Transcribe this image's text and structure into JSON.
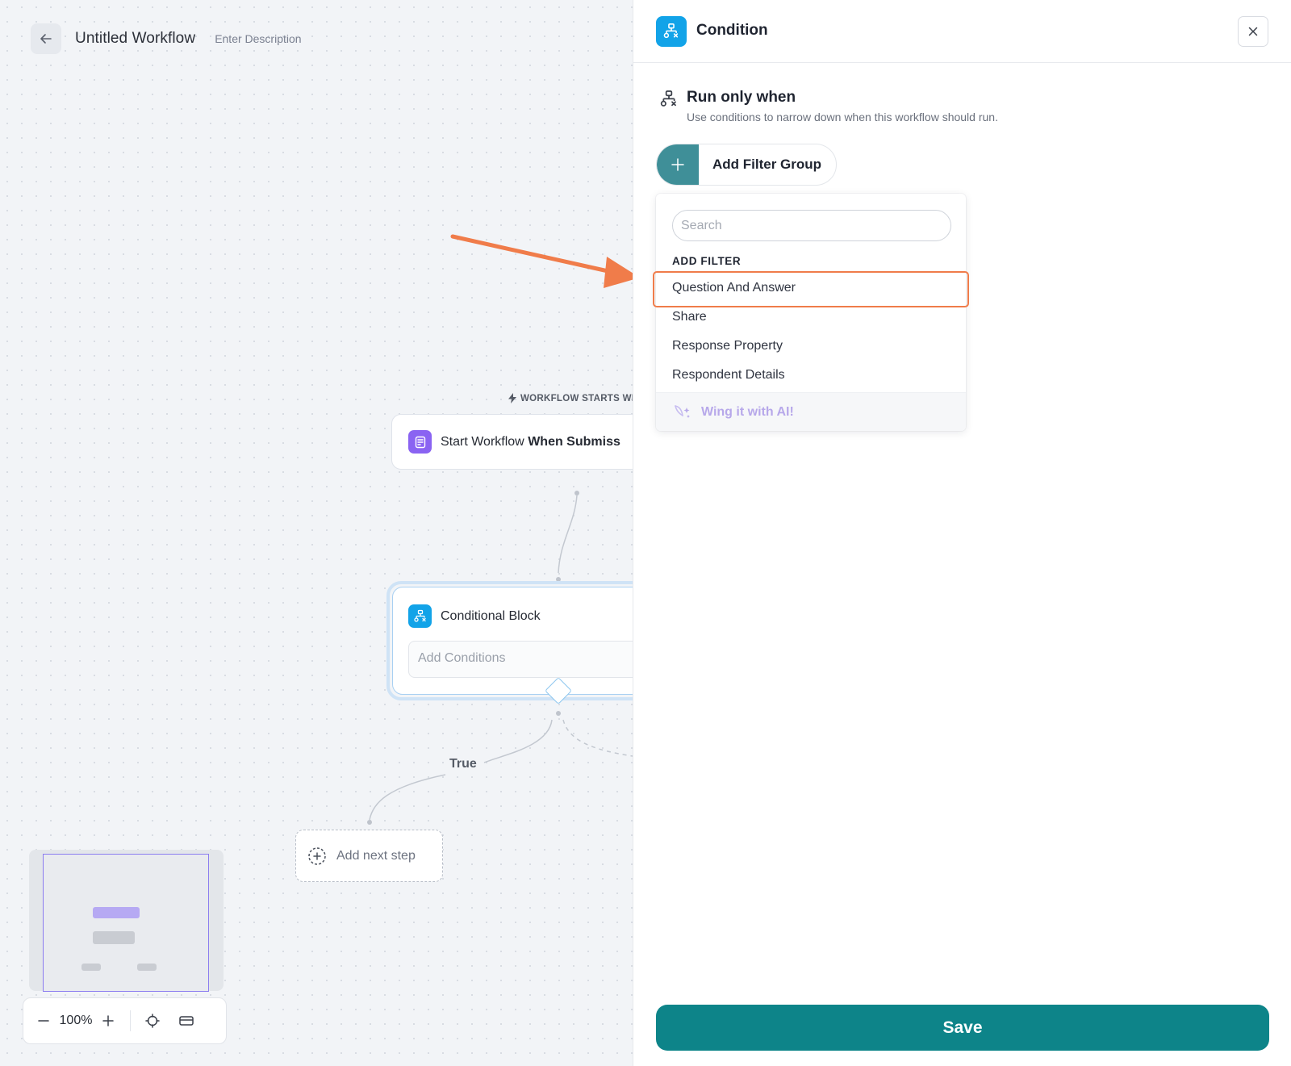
{
  "topbar": {
    "title": "Untitled Workflow",
    "description": "Enter Description"
  },
  "canvas": {
    "starts_label": "WORKFLOW STARTS WH",
    "trigger_node": {
      "prefix": "Start Workflow",
      "bold": "When Submiss"
    },
    "condition_node": {
      "title": "Conditional Block",
      "placeholder": "Add Conditions"
    },
    "branch_label": "True",
    "add_step_label": "Add next step",
    "zoom": {
      "value": "100%"
    }
  },
  "panel": {
    "title": "Condition",
    "section_title": "Run only when",
    "section_subtitle": "Use conditions to narrow down when this workflow should run.",
    "add_filter_group_label": "Add Filter Group",
    "dropdown": {
      "search_placeholder": "Search",
      "heading": "ADD FILTER",
      "items": [
        "Question And Answer",
        "Share",
        "Response Property",
        "Respondent Details"
      ],
      "highlighted_item": "Question And Answer",
      "ai_label": "Wing it with AI!"
    },
    "save_label": "Save"
  },
  "colors": {
    "accent_teal": "#0d8489",
    "icon_blue": "#12a3e8",
    "icon_purple": "#8a63f2",
    "annotation_orange": "#f07c4a"
  }
}
